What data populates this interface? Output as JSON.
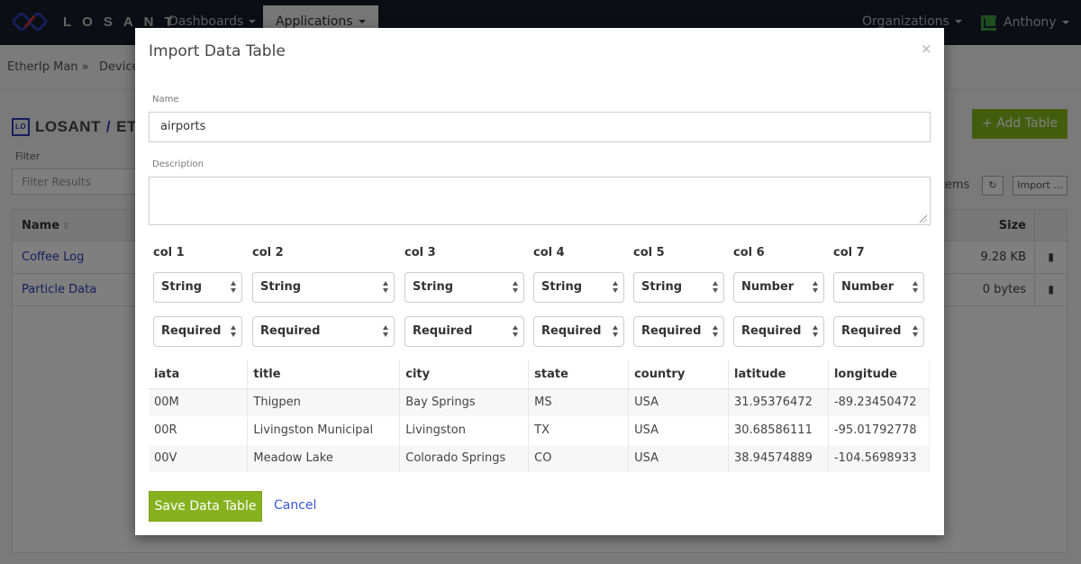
{
  "navbar": {
    "brand": "LOSANT",
    "items": [
      {
        "label": "Dashboards"
      },
      {
        "label": "Applications"
      }
    ],
    "organizations_label": "Organizations",
    "user_name": "Anthony"
  },
  "subnav": {
    "breadcrumb_app": "EtherIp Man »",
    "breadcrumb_devices": "Devices"
  },
  "page": {
    "app_icon_text": "LO",
    "title_org": "LOSANT",
    "title_sep": "/",
    "title_app": "ETHERIP MAN",
    "filter_label": "Filter",
    "filter_placeholder": "Filter Results",
    "add_table_label": "+ Add Table",
    "items_text": "Items",
    "import_label": "Import ...",
    "table": {
      "headers": {
        "name": "Name",
        "size": "Size"
      },
      "rows": [
        {
          "name": "Coffee Log",
          "size": "9.28 KB"
        },
        {
          "name": "Particle Data",
          "size": "0 bytes"
        }
      ]
    }
  },
  "modal": {
    "title": "Import Data Table",
    "close_symbol": "×",
    "name_label": "Name",
    "name_value": "airports",
    "description_label": "Description",
    "description_value": "",
    "columns": [
      {
        "label": "col 1",
        "type": "String",
        "requirement": "Required"
      },
      {
        "label": "col 2",
        "type": "String",
        "requirement": "Required"
      },
      {
        "label": "col 3",
        "type": "String",
        "requirement": "Required"
      },
      {
        "label": "col 4",
        "type": "String",
        "requirement": "Required"
      },
      {
        "label": "col 5",
        "type": "String",
        "requirement": "Required"
      },
      {
        "label": "col 6",
        "type": "Number",
        "requirement": "Required"
      },
      {
        "label": "col 7",
        "type": "Number",
        "requirement": "Required"
      }
    ],
    "preview": {
      "headers": [
        "iata",
        "title",
        "city",
        "state",
        "country",
        "latitude",
        "longitude"
      ],
      "rows": [
        [
          "00M",
          "Thigpen",
          "Bay Springs",
          "MS",
          "USA",
          "31.95376472",
          "-89.23450472"
        ],
        [
          "00R",
          "Livingston Municipal",
          "Livingston",
          "TX",
          "USA",
          "30.68586111",
          "-95.01792778"
        ],
        [
          "00V",
          "Meadow Lake",
          "Colorado Springs",
          "CO",
          "USA",
          "38.94574889",
          "-104.5698933"
        ]
      ]
    },
    "save_label": "Save Data Table",
    "cancel_label": "Cancel"
  },
  "colors": {
    "navbar_bg": "#161d2b",
    "accent_green": "#87b21f",
    "link_blue": "#3a55d8",
    "brand_blue": "#2b3fb5",
    "brand_red": "#c8343a"
  }
}
